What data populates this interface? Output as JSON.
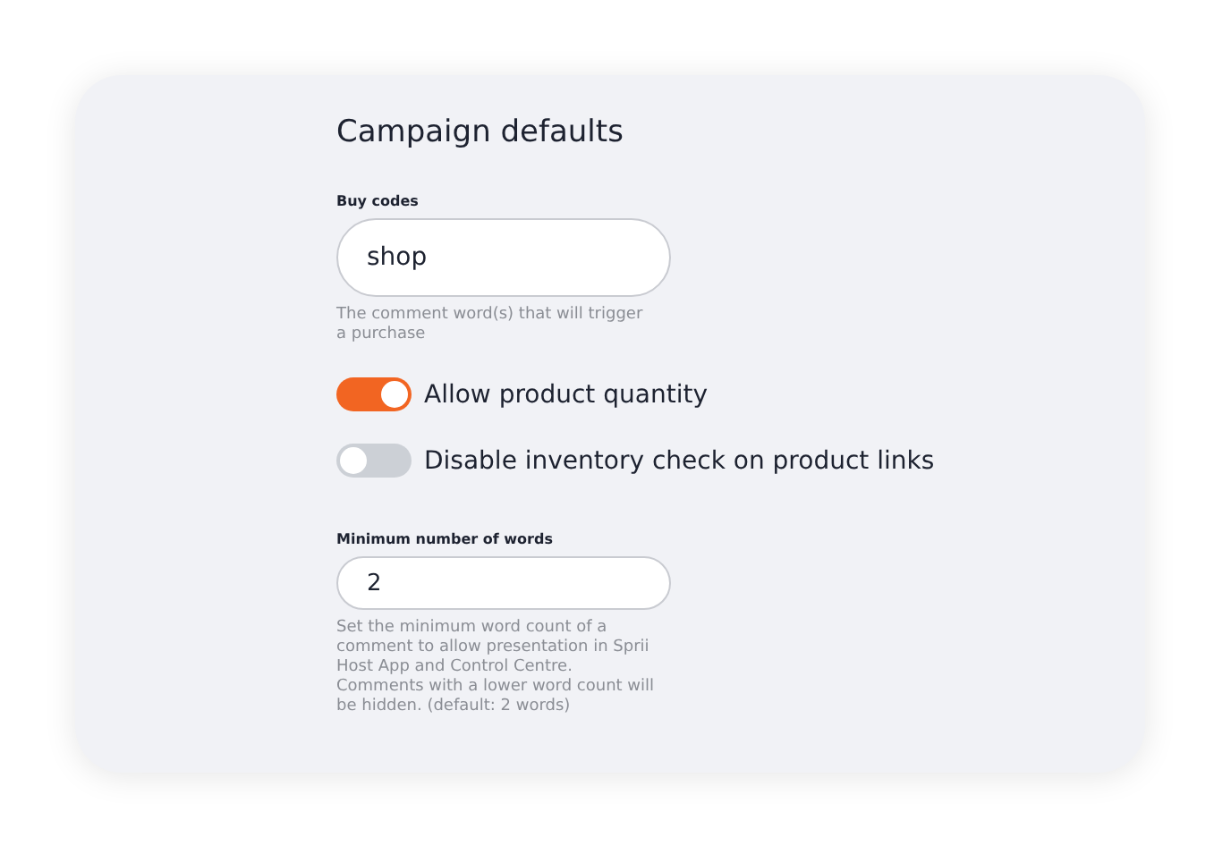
{
  "title": "Campaign defaults",
  "settings": [
    {
      "kind": "field",
      "label": "Buy codes",
      "value": "shop",
      "help": "The comment word(s) that will trigger a purchase"
    },
    {
      "kind": "toggle",
      "label": "Allow product quantity",
      "on": true
    },
    {
      "kind": "toggle",
      "label": "Disable inventory check on product links",
      "on": false
    },
    {
      "kind": "slimfield",
      "label": "Minimum number of words",
      "value": "2",
      "help": "Set the minimum word count of a comment to allow presentation in Sprii Host App and Control Centre. Comments with a lower word count will be hidden. (default: 2 words)"
    }
  ]
}
